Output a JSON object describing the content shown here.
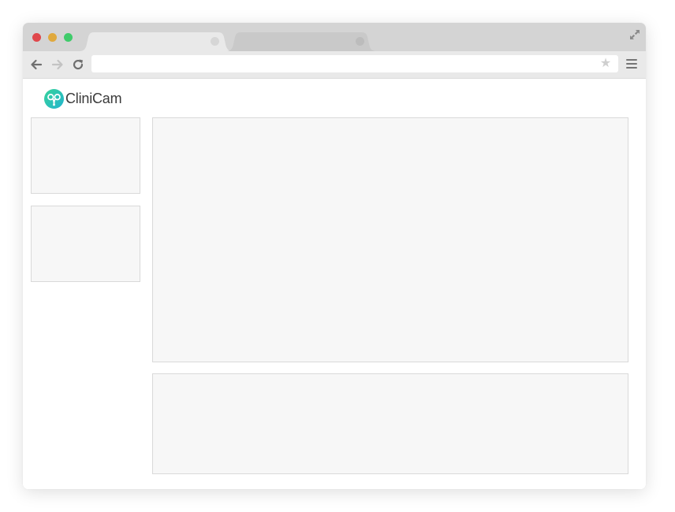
{
  "browser": {
    "window_controls": [
      "close",
      "minimize",
      "maximize"
    ],
    "tabs": [
      {
        "label": "",
        "active": true
      },
      {
        "label": "",
        "active": false
      }
    ],
    "address_bar": {
      "value": "",
      "placeholder": ""
    },
    "icons": {
      "back": "back-arrow-icon",
      "forward": "forward-arrow-icon",
      "reload": "reload-icon",
      "bookmark": "star-icon",
      "menu": "hamburger-menu-icon",
      "fullscreen": "fullscreen-icon"
    }
  },
  "app": {
    "logo_text": "CliniCam",
    "brand_colors": {
      "primary": "#2fc7a2",
      "secondary": "#27b7d0"
    }
  },
  "layout_panels": {
    "sidebar": [
      {
        "name": "sidebar-card-1",
        "content": ""
      },
      {
        "name": "sidebar-card-2",
        "content": ""
      }
    ],
    "main": {
      "content": ""
    },
    "bottom": {
      "content": ""
    }
  }
}
